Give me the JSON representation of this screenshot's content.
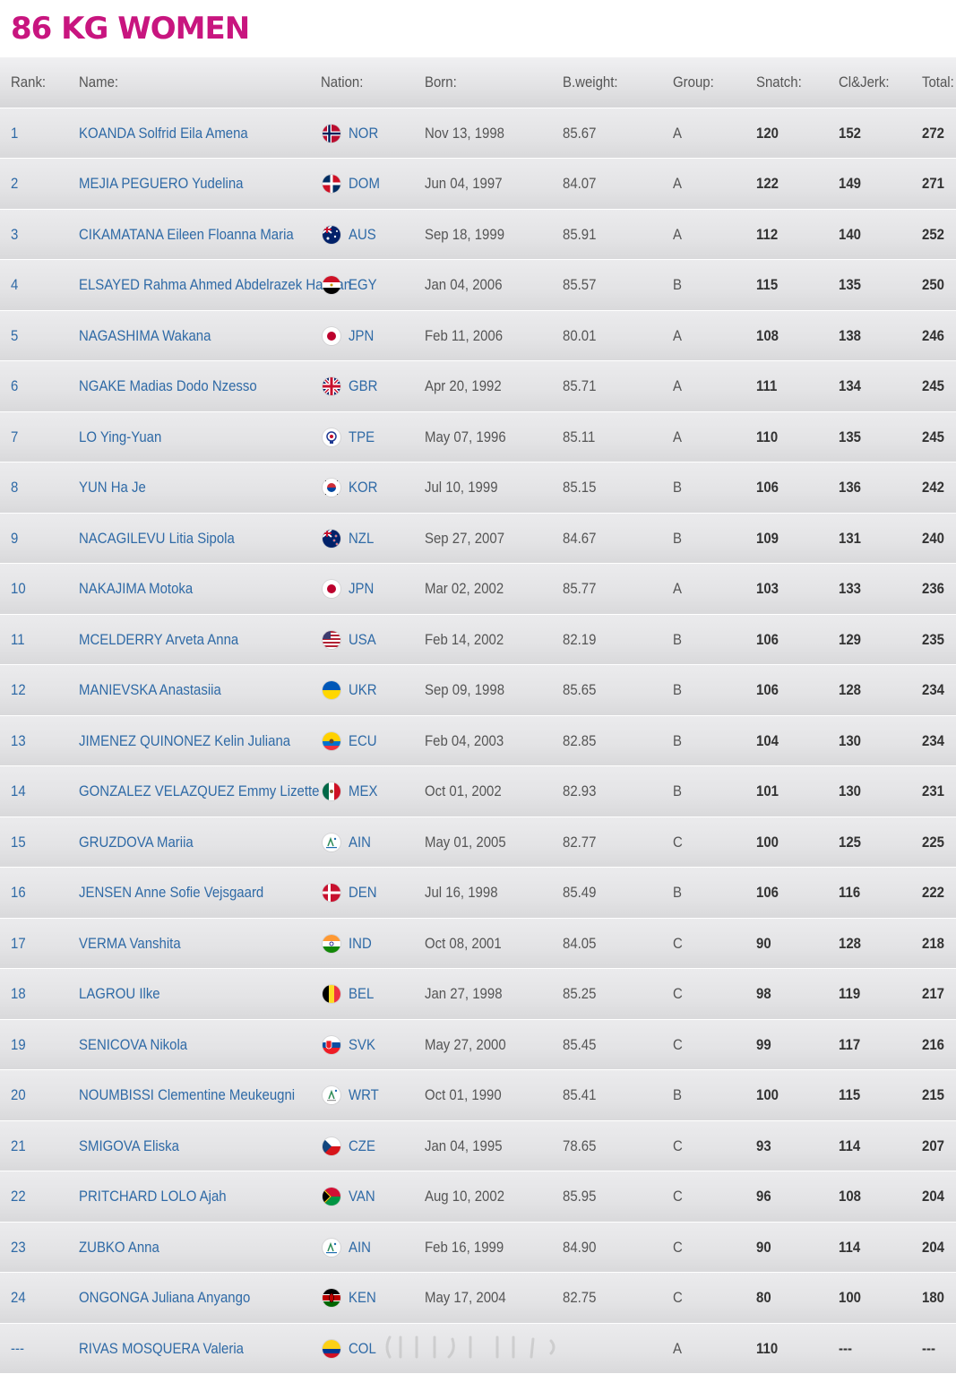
{
  "title": "86 KG WOMEN",
  "columns": {
    "rank": "Rank:",
    "name": "Name:",
    "nation": "Nation:",
    "born": "Born:",
    "bweight": "B.weight:",
    "group": "Group:",
    "snatch": "Snatch:",
    "cj": "Cl&Jerk:",
    "total": "Total:"
  },
  "rows": [
    {
      "rank": "1",
      "name": "KOANDA Solfrid Eila Amena",
      "nation": "NOR",
      "flag": "norway-flag-icon",
      "born": "Nov 13, 1998",
      "bweight": "85.67",
      "group": "A",
      "snatch": "120",
      "cj": "152",
      "total": "272"
    },
    {
      "rank": "2",
      "name": "MEJIA PEGUERO Yudelina",
      "nation": "DOM",
      "flag": "dominican-republic-flag-icon",
      "born": "Jun 04, 1997",
      "bweight": "84.07",
      "group": "A",
      "snatch": "122",
      "cj": "149",
      "total": "271"
    },
    {
      "rank": "3",
      "name": "CIKAMATANA Eileen Floanna Maria",
      "nation": "AUS",
      "flag": "australia-flag-icon",
      "born": "Sep 18, 1999",
      "bweight": "85.91",
      "group": "A",
      "snatch": "112",
      "cj": "140",
      "total": "252"
    },
    {
      "rank": "4",
      "name": "ELSAYED Rahma Ahmed Abdelrazek Hassan",
      "nation": "EGY",
      "flag": "egypt-flag-icon",
      "born": "Jan 04, 2006",
      "bweight": "85.57",
      "group": "B",
      "snatch": "115",
      "cj": "135",
      "total": "250"
    },
    {
      "rank": "5",
      "name": "NAGASHIMA Wakana",
      "nation": "JPN",
      "flag": "japan-flag-icon",
      "born": "Feb 11, 2006",
      "bweight": "80.01",
      "group": "A",
      "snatch": "108",
      "cj": "138",
      "total": "246"
    },
    {
      "rank": "6",
      "name": "NGAKE Madias Dodo Nzesso",
      "nation": "GBR",
      "flag": "great-britain-flag-icon",
      "born": "Apr 20, 1992",
      "bweight": "85.71",
      "group": "A",
      "snatch": "111",
      "cj": "134",
      "total": "245"
    },
    {
      "rank": "7",
      "name": "LO Ying-Yuan",
      "nation": "TPE",
      "flag": "chinese-taipei-flag-icon",
      "born": "May 07, 1996",
      "bweight": "85.11",
      "group": "A",
      "snatch": "110",
      "cj": "135",
      "total": "245"
    },
    {
      "rank": "8",
      "name": "YUN Ha Je",
      "nation": "KOR",
      "flag": "south-korea-flag-icon",
      "born": "Jul 10, 1999",
      "bweight": "85.15",
      "group": "B",
      "snatch": "106",
      "cj": "136",
      "total": "242"
    },
    {
      "rank": "9",
      "name": "NACAGILEVU Litia Sipola",
      "nation": "NZL",
      "flag": "new-zealand-flag-icon",
      "born": "Sep 27, 2007",
      "bweight": "84.67",
      "group": "B",
      "snatch": "109",
      "cj": "131",
      "total": "240"
    },
    {
      "rank": "10",
      "name": "NAKAJIMA Motoka",
      "nation": "JPN",
      "flag": "japan-flag-icon",
      "born": "Mar 02, 2002",
      "bweight": "85.77",
      "group": "A",
      "snatch": "103",
      "cj": "133",
      "total": "236"
    },
    {
      "rank": "11",
      "name": "MCELDERRY Arveta Anna",
      "nation": "USA",
      "flag": "usa-flag-icon",
      "born": "Feb 14, 2002",
      "bweight": "82.19",
      "group": "B",
      "snatch": "106",
      "cj": "129",
      "total": "235"
    },
    {
      "rank": "12",
      "name": "MANIEVSKA Anastasiia",
      "nation": "UKR",
      "flag": "ukraine-flag-icon",
      "born": "Sep 09, 1998",
      "bweight": "85.65",
      "group": "B",
      "snatch": "106",
      "cj": "128",
      "total": "234"
    },
    {
      "rank": "13",
      "name": "JIMENEZ QUINONEZ Kelin Juliana",
      "nation": "ECU",
      "flag": "ecuador-flag-icon",
      "born": "Feb 04, 2003",
      "bweight": "82.85",
      "group": "B",
      "snatch": "104",
      "cj": "130",
      "total": "234"
    },
    {
      "rank": "14",
      "name": "GONZALEZ VELAZQUEZ Emmy Lizette",
      "nation": "MEX",
      "flag": "mexico-flag-icon",
      "born": "Oct 01, 2002",
      "bweight": "82.93",
      "group": "B",
      "snatch": "101",
      "cj": "130",
      "total": "231"
    },
    {
      "rank": "15",
      "name": "GRUZDOVA Mariia",
      "nation": "AIN",
      "flag": "neutral-athlete-icon",
      "born": "May 01, 2005",
      "bweight": "82.77",
      "group": "C",
      "snatch": "100",
      "cj": "125",
      "total": "225"
    },
    {
      "rank": "16",
      "name": "JENSEN Anne Sofie Vejsgaard",
      "nation": "DEN",
      "flag": "denmark-flag-icon",
      "born": "Jul 16, 1998",
      "bweight": "85.49",
      "group": "B",
      "snatch": "106",
      "cj": "116",
      "total": "222"
    },
    {
      "rank": "17",
      "name": "VERMA Vanshita",
      "nation": "IND",
      "flag": "india-flag-icon",
      "born": "Oct 08, 2001",
      "bweight": "84.05",
      "group": "C",
      "snatch": "90",
      "cj": "128",
      "total": "218"
    },
    {
      "rank": "18",
      "name": "LAGROU Ilke",
      "nation": "BEL",
      "flag": "belgium-flag-icon",
      "born": "Jan 27, 1998",
      "bweight": "85.25",
      "group": "C",
      "snatch": "98",
      "cj": "119",
      "total": "217"
    },
    {
      "rank": "19",
      "name": "SENICOVA Nikola",
      "nation": "SVK",
      "flag": "slovakia-flag-icon",
      "born": "May 27, 2000",
      "bweight": "85.45",
      "group": "C",
      "snatch": "99",
      "cj": "117",
      "total": "216"
    },
    {
      "rank": "20",
      "name": "NOUMBISSI Clementine Meukeugni",
      "nation": "WRT",
      "flag": "refugee-team-icon",
      "born": "Oct 01, 1990",
      "bweight": "85.41",
      "group": "B",
      "snatch": "100",
      "cj": "115",
      "total": "215"
    },
    {
      "rank": "21",
      "name": "SMIGOVA Eliska",
      "nation": "CZE",
      "flag": "czechia-flag-icon",
      "born": "Jan 04, 1995",
      "bweight": "78.65",
      "group": "C",
      "snatch": "93",
      "cj": "114",
      "total": "207"
    },
    {
      "rank": "22",
      "name": "PRITCHARD LOLO Ajah",
      "nation": "VAN",
      "flag": "vanuatu-flag-icon",
      "born": "Aug 10, 2002",
      "bweight": "85.95",
      "group": "C",
      "snatch": "96",
      "cj": "108",
      "total": "204"
    },
    {
      "rank": "23",
      "name": "ZUBKO Anna",
      "nation": "AIN",
      "flag": "neutral-athlete-icon",
      "born": "Feb 16, 1999",
      "bweight": "84.90",
      "group": "C",
      "snatch": "90",
      "cj": "114",
      "total": "204"
    },
    {
      "rank": "24",
      "name": "ONGONGA Juliana Anyango",
      "nation": "KEN",
      "flag": "kenya-flag-icon",
      "born": "May 17, 2004",
      "bweight": "82.75",
      "group": "C",
      "snatch": "80",
      "cj": "100",
      "total": "180"
    },
    {
      "rank": "---",
      "name": "RIVAS MOSQUERA Valeria",
      "nation": "COL",
      "flag": "colombia-flag-icon",
      "born": "",
      "bweight": "",
      "group": "A",
      "snatch": "110",
      "cj": "---",
      "total": "---"
    }
  ]
}
